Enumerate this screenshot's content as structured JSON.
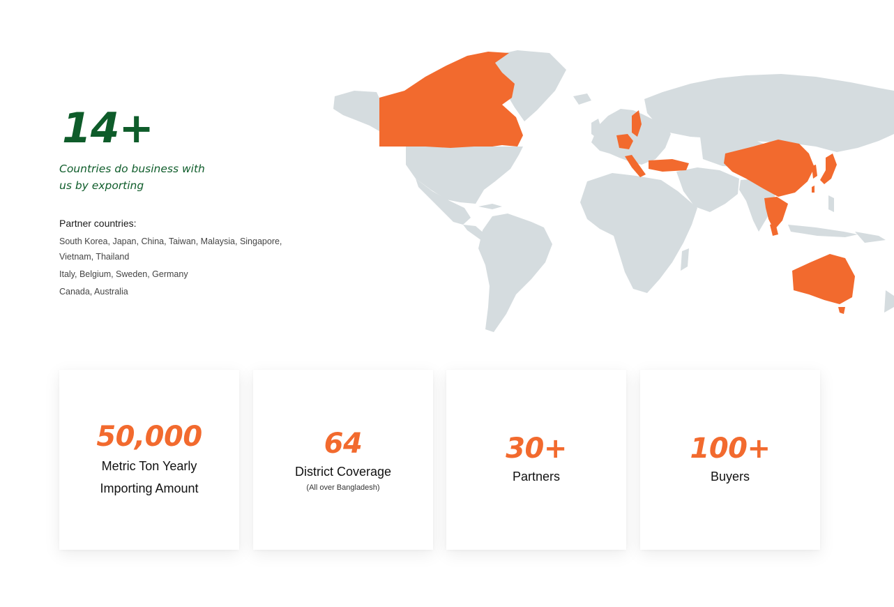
{
  "highlight": {
    "count": "14+",
    "caption_line1": "Countries do business with",
    "caption_line2": "us by exporting"
  },
  "partners": {
    "heading": "Partner countries:",
    "lines": [
      "South Korea, Japan, China, Taiwan, Malaysia, Singapore, Vietnam, Thailand",
      "Italy, Belgium, Sweden, Germany",
      "Canada, Australia"
    ]
  },
  "map": {
    "land_color": "#d5dcdf",
    "highlight_color": "#f26a2e",
    "highlighted_countries": [
      "Canada",
      "Italy",
      "Belgium",
      "Sweden",
      "Germany",
      "Turkey",
      "China",
      "South Korea",
      "Japan",
      "Taiwan",
      "Vietnam",
      "Thailand",
      "Malaysia",
      "Singapore",
      "Australia"
    ]
  },
  "stats": [
    {
      "value": "50,000",
      "label_line1": "Metric Ton Yearly",
      "label_line2": "Importing Amount",
      "note": ""
    },
    {
      "value": "64",
      "label_line1": "District Coverage",
      "label_line2": "",
      "note": "(All over Bangladesh)"
    },
    {
      "value": "30+",
      "label_line1": "Partners",
      "label_line2": "",
      "note": ""
    },
    {
      "value": "100+",
      "label_line1": "Buyers",
      "label_line2": "",
      "note": ""
    }
  ],
  "colors": {
    "brand_green": "#0e5c2a",
    "accent_orange": "#f26a2e"
  }
}
